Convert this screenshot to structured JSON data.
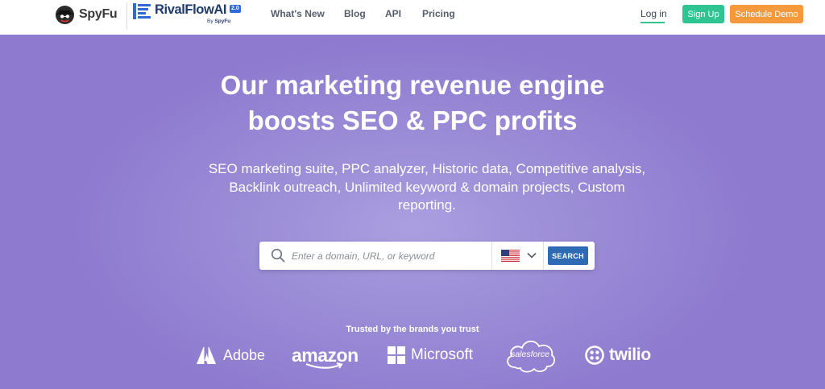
{
  "nav": {
    "spyfu_logo": "SpyFu",
    "rivalflow_logo": "RivalFlowAI",
    "rivalflow_version": "2.0",
    "rivalflow_by_prefix": "By",
    "rivalflow_by_brand": "SpyFu",
    "links": [
      "What's New",
      "Blog",
      "API",
      "Pricing"
    ],
    "login": "Log in",
    "signup": "Sign Up",
    "schedule_demo": "Schedule Demo"
  },
  "hero": {
    "headline_line1": "Our marketing revenue engine",
    "headline_line2": "boosts SEO & PPC profits",
    "subhead_line1": "SEO marketing suite, PPC analyzer, Historic data, Competitive analysis,",
    "subhead_line2": "Backlink outreach, Unlimited keyword & domain projects, Custom",
    "subhead_line3": "reporting."
  },
  "search": {
    "placeholder": "Enter a domain, URL, or keyword",
    "country": "us-flag-icon",
    "button": "SEARCH"
  },
  "brands": {
    "heading": "Trusted by the brands you trust",
    "adobe": "Adobe",
    "amazon": "amazon",
    "microsoft": "Microsoft",
    "salesforce": "salesforce",
    "twilio": "twilio"
  },
  "colors": {
    "hero_bg": "#8e7bcf",
    "signup": "#2fc592",
    "demo": "#f59a3c",
    "search_button": "#2f6bb5"
  }
}
